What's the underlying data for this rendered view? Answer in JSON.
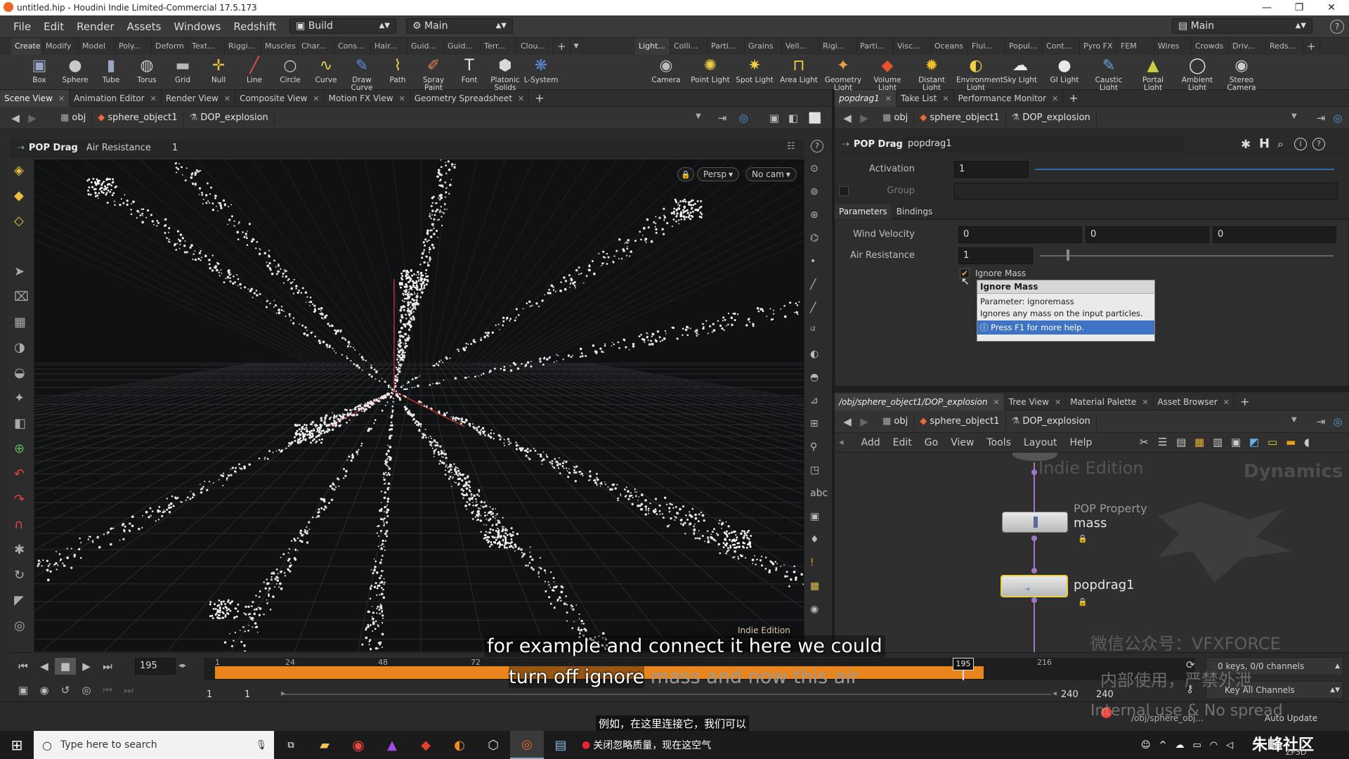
{
  "window": {
    "title": "untitled.hip - Houdini Indie Limited-Commercial 17.5.173",
    "controls": [
      "—",
      "❐",
      "✕"
    ]
  },
  "menubar": {
    "items": [
      "File",
      "Edit",
      "Render",
      "Assets",
      "Windows",
      "Redshift",
      "Help"
    ],
    "desktop_left": "Build",
    "desktop_right": "Main",
    "desktop_far": "Main"
  },
  "shelf_tabs_left": [
    "Create",
    "Modify",
    "Model",
    "Poly...",
    "Deform",
    "Text...",
    "Riggi...",
    "Muscles",
    "Char...",
    "Cons...",
    "Hair...",
    "Guid...",
    "Guid...",
    "Terr...",
    "Clou..."
  ],
  "shelf_tabs_right": [
    "Light...",
    "Colli...",
    "Parti...",
    "Grains",
    "Vell...",
    "Rigi...",
    "Parti...",
    "Visc...",
    "Oceans",
    "Flui...",
    "Popul...",
    "Cont...",
    "Pyro FX",
    "FEM",
    "Wires",
    "Crowds",
    "Driv...",
    "Reds..."
  ],
  "tools_left": [
    {
      "label": "Box",
      "icon": "box-icon"
    },
    {
      "label": "Sphere",
      "icon": "sphere-icon"
    },
    {
      "label": "Tube",
      "icon": "tube-icon"
    },
    {
      "label": "Torus",
      "icon": "torus-icon"
    },
    {
      "label": "Grid",
      "icon": "grid-icon"
    },
    {
      "label": "Null",
      "icon": "null-icon"
    },
    {
      "label": "Line",
      "icon": "line-icon"
    },
    {
      "label": "Circle",
      "icon": "circle-icon"
    },
    {
      "label": "Curve",
      "icon": "curve-icon"
    },
    {
      "label": "Draw Curve",
      "icon": "draw-curve-icon"
    },
    {
      "label": "Path",
      "icon": "path-icon"
    },
    {
      "label": "Spray Paint",
      "icon": "spray-paint-icon"
    },
    {
      "label": "Font",
      "icon": "font-icon"
    },
    {
      "label": "Platonic Solids",
      "icon": "platonic-solids-icon"
    },
    {
      "label": "L-System",
      "icon": "l-system-icon"
    }
  ],
  "tools_right": [
    {
      "label": "Camera",
      "icon": "camera-icon"
    },
    {
      "label": "Point Light",
      "icon": "point-light-icon"
    },
    {
      "label": "Spot Light",
      "icon": "spot-light-icon"
    },
    {
      "label": "Area Light",
      "icon": "area-light-icon"
    },
    {
      "label": "Geometry Light",
      "icon": "geometry-light-icon"
    },
    {
      "label": "Volume Light",
      "icon": "volume-light-icon"
    },
    {
      "label": "Distant Light",
      "icon": "distant-light-icon"
    },
    {
      "label": "Environment Light",
      "icon": "environment-light-icon"
    },
    {
      "label": "Sky Light",
      "icon": "sky-light-icon"
    },
    {
      "label": "GI Light",
      "icon": "gi-light-icon"
    },
    {
      "label": "Caustic Light",
      "icon": "caustic-light-icon"
    },
    {
      "label": "Portal Light",
      "icon": "portal-light-icon"
    },
    {
      "label": "Ambient Light",
      "icon": "ambient-light-icon"
    },
    {
      "label": "Stereo Camera",
      "icon": "stereo-camera-icon"
    }
  ],
  "left_pane": {
    "tabs": [
      "Scene View",
      "Animation Editor",
      "Render View",
      "Composite View",
      "Motion FX View",
      "Geometry Spreadsheet"
    ],
    "path": [
      "obj",
      "sphere_object1",
      "DOP_explosion"
    ],
    "op_type": "POP Drag",
    "op_param_label": "Air Resistance",
    "op_param_value": "1",
    "persp": "Persp",
    "cam": "No cam",
    "watermark": "Indie Edition"
  },
  "parm_pane": {
    "tabs": [
      "popdrag1",
      "Take List",
      "Performance Monitor"
    ],
    "path": [
      "obj",
      "sphere_object1",
      "DOP_explosion"
    ],
    "op_type": "POP Drag",
    "node_name": "popdrag1",
    "activation_label": "Activation",
    "activation_value": "1",
    "group_label": "Group",
    "subtabs": [
      "Parameters",
      "Bindings"
    ],
    "wind_label": "Wind Velocity",
    "wind_values": [
      "0",
      "0",
      "0"
    ],
    "air_label": "Air Resistance",
    "air_value": "1",
    "ignore_label": "Ignore Mass",
    "tooltip": {
      "title": "Ignore Mass",
      "parameter": "Parameter: ignoremass",
      "desc": "Ignores any  mass  on the input particles.",
      "help": "Press F1 for more help."
    }
  },
  "network_pane": {
    "tabs": [
      "/obj/sphere_object1/DOP_explosion",
      "Tree View",
      "Material Palette",
      "Asset Browser"
    ],
    "path": [
      "obj",
      "sphere_object1",
      "DOP_explosion"
    ],
    "menu": [
      "Add",
      "Edit",
      "Go",
      "View",
      "Tools",
      "Layout",
      "Help"
    ],
    "indie": "Indie Edition",
    "context": "Dynamics",
    "nodes": [
      {
        "type": "POP Property",
        "name": "mass"
      },
      {
        "type": "",
        "name": "popdrag1"
      }
    ]
  },
  "timeline": {
    "frame": "195",
    "start": "1",
    "start2": "1",
    "end": "240",
    "end2": "240",
    "marker": "195",
    "ticks": [
      "1",
      "24",
      "48",
      "72",
      "216"
    ],
    "keys": "0 keys, 0/0 channels",
    "key_all": "Key All Channels",
    "auto_update": "Auto Update",
    "status_path": "/obj/sphere_obj..."
  },
  "subtitles": {
    "line1": "for example and connect it here we could",
    "line2a": "turn off ignore",
    "line2b": " mass and now this air",
    "cn": "例如，在这里连接它，我们可以",
    "cn2": "关闭忽略质量，现在这空气"
  },
  "watermarks": {
    "wechat": "微信公众号：VFXFORCE",
    "internal": "内部使用，严禁外泄",
    "internaluse": "Internal use & No spread",
    "site": "朱峰社区",
    "site2": "ZF3D"
  },
  "taskbar": {
    "search_placeholder": "Type here to search"
  }
}
